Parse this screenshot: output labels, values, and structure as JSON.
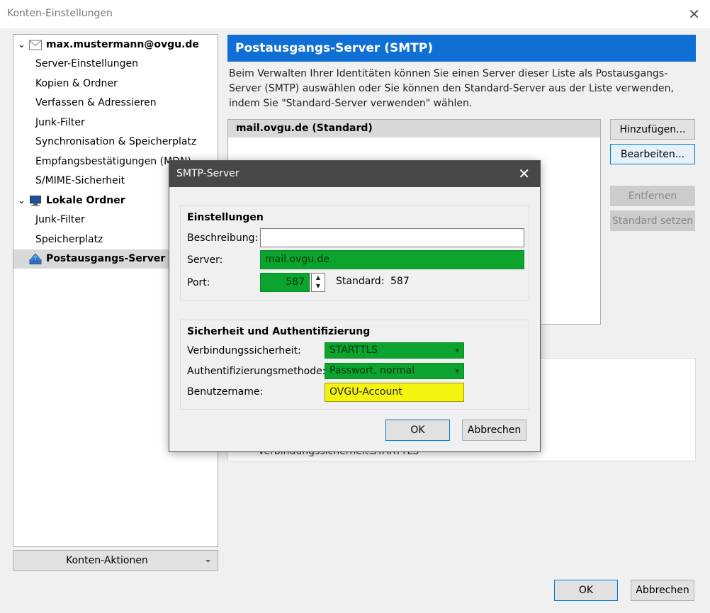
{
  "window": {
    "title": "Konten-Einstellungen",
    "close_glyph": "✕"
  },
  "sidebar": {
    "account_email": "max.mustermann@ovgu.de",
    "account_items": [
      "Server-Einstellungen",
      "Kopien & Ordner",
      "Verfassen & Adressieren",
      "Junk-Filter",
      "Synchronisation & Speicherplatz",
      "Empfangsbestätigungen (MDN)",
      "S/MIME-Sicherheit"
    ],
    "local_folders": "Lokale Ordner",
    "local_items": [
      "Junk-Filter",
      "Speicherplatz"
    ],
    "smtp_item": "Postausgangs-Server (SMTP)",
    "chevron": "✓"
  },
  "konten_aktionen": {
    "label": "Konten-Aktionen",
    "caret": "⌄"
  },
  "main": {
    "header": "Postausgangs-Server (SMTP)",
    "description": "Beim Verwalten Ihrer Identitäten können Sie einen Server dieser Liste als Postausgangs-Server (SMTP) auswählen oder Sie können den Standard-Server aus der Liste verwenden, indem Sie \"Standard-Server verwenden\" wählen.",
    "server_list_header": "mail.ovgu.de (Standard)",
    "buttons": {
      "add": "Hinzufügen...",
      "edit": "Bearbeiten...",
      "remove": "Entfernen",
      "set_default": "Standard setzen"
    },
    "details_peek_label": "Verbindungssicherheit:",
    "details_peek_value": "STARTTLS"
  },
  "footer": {
    "ok": "OK",
    "cancel": "Abbrechen"
  },
  "dialog": {
    "title": "SMTP-Server",
    "close_glyph": "✕",
    "settings_group": "Einstellungen",
    "description_label": "Beschreibung:",
    "description_value": "",
    "server_label": "Server:",
    "server_value": "mail.ovgu.de",
    "port_label": "Port:",
    "port_value": "587",
    "standard_label": "Standard:",
    "standard_value": "587",
    "security_group": "Sicherheit und Authentifizierung",
    "conn_security_label": "Verbindungssicherheit:",
    "conn_security_value": "STARTTLS",
    "auth_label": "Authentifizierungsmethode:",
    "auth_value": "Passwort, normal",
    "username_label": "Benutzername:",
    "username_value": "OVGU-Account",
    "ok": "OK",
    "cancel": "Abbrechen",
    "colors": {
      "highlight_green": "#0ca32e",
      "highlight_yellow": "#f4f410"
    }
  },
  "colors": {
    "accent": "#0f6fd5",
    "dialog_title_bg": "#474747"
  }
}
